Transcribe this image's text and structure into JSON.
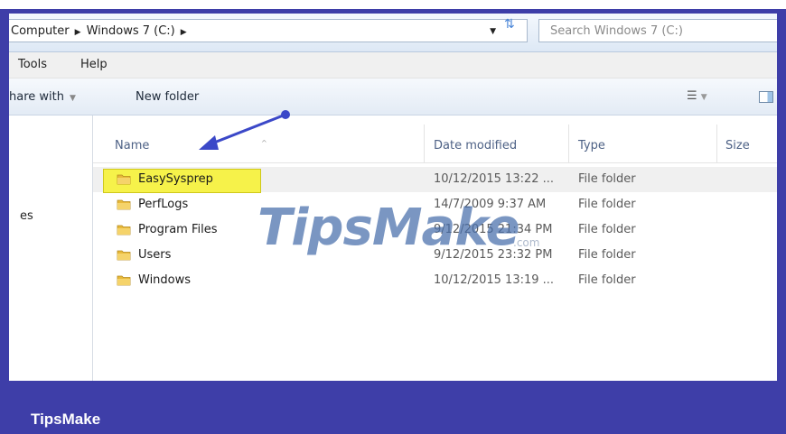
{
  "address": {
    "crumbs": [
      "Computer",
      "Windows 7 (C:)"
    ],
    "search_placeholder": "Search Windows 7 (C:)"
  },
  "menu": {
    "tools": "Tools",
    "help": "Help"
  },
  "commandbar": {
    "share_with": "hare with",
    "new_folder": "New folder"
  },
  "nav": {
    "partial_label": "es"
  },
  "columns": {
    "name": "Name",
    "date": "Date modified",
    "type": "Type",
    "size": "Size"
  },
  "files": [
    {
      "name": "EasySysprep",
      "date": "10/12/2015 13:22 ...",
      "type": "File folder",
      "highlighted": true
    },
    {
      "name": "PerfLogs",
      "date": "14/7/2009 9:37 AM",
      "type": "File folder"
    },
    {
      "name": "Program Files",
      "date": "9/12/2015 21:34 PM",
      "type": "File folder"
    },
    {
      "name": "Users",
      "date": "9/12/2015 23:32 PM",
      "type": "File folder"
    },
    {
      "name": "Windows",
      "date": "10/12/2015 13:19 ...",
      "type": "File folder"
    }
  ],
  "watermark": {
    "text": "TipsMake",
    "suffix": ".com"
  },
  "brand": "TipsMake",
  "colors": {
    "frame": "#3e3ea8",
    "highlight": "#f6f24a",
    "arrow": "#3b48c8"
  }
}
